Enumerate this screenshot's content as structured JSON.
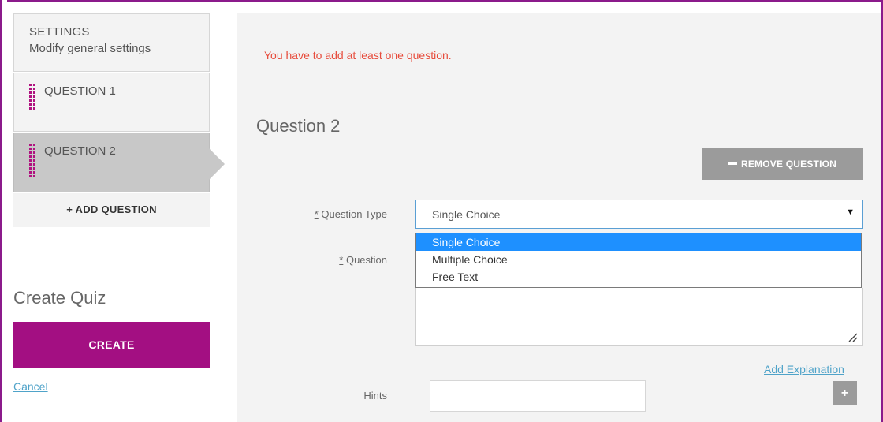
{
  "sidebar": {
    "settings": {
      "title": "SETTINGS",
      "subtitle": "Modify general settings"
    },
    "questions": [
      {
        "label": "QUESTION 1"
      },
      {
        "label": "QUESTION 2"
      }
    ],
    "add_question_label": "+ ADD QUESTION",
    "create_quiz_title": "Create Quiz",
    "create_label": "CREATE",
    "cancel_label": "Cancel"
  },
  "main": {
    "error": "You have to add at least one question.",
    "heading": "Question 2",
    "remove_label": "REMOVE QUESTION",
    "question_type": {
      "required_mark": "*",
      "label": "Question Type",
      "value": "Single Choice",
      "options": [
        "Single Choice",
        "Multiple Choice",
        "Free Text"
      ],
      "selected_index": 0
    },
    "question": {
      "required_mark": "*",
      "label": "Question",
      "value": ""
    },
    "add_explanation_label": "Add Explanation",
    "hints": {
      "label": "Hints",
      "value": "",
      "add_label": "+"
    }
  },
  "colors": {
    "accent": "#a30f82",
    "error": "#e74c3c",
    "link": "#4fa3c9",
    "selected_option": "#1e90ff",
    "frame": "#8b1a8b"
  },
  "icons": {
    "drag_handle": "drag-handle-icon",
    "select_caret": "caret-down-icon",
    "resize_grip": "resize-grip-icon",
    "minus": "minus-icon"
  }
}
